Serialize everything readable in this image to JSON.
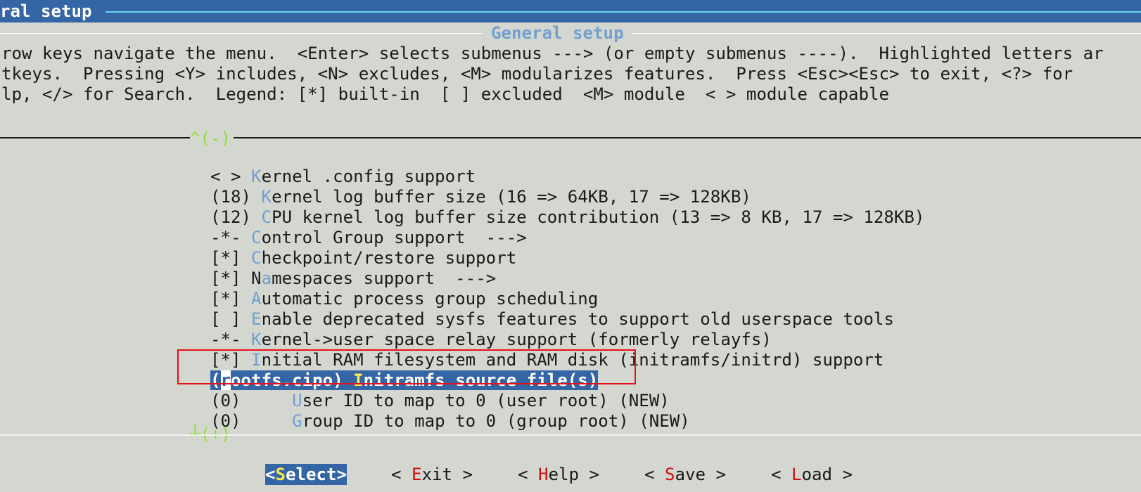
{
  "header": {
    "title": "ral setup"
  },
  "dialog": {
    "title": "General setup",
    "help_lines": [
      "row keys navigate the menu.  <Enter> selects submenus ---> (or empty submenus ----).  Highlighted letters ar",
      "tkeys.  Pressing <Y> includes, <N> excludes, <M> modularizes features.  Press <Esc><Esc> to exit, <?> for",
      "lp, </> for Search.  Legend: [*] built-in  [ ] excluded  <M> module  < > module capable"
    ]
  },
  "menu": {
    "scroll_up": "^(-)",
    "scroll_down": "┴(+)",
    "items": [
      {
        "prefix": "< > ",
        "pre_hot": "",
        "hot": "K",
        "rest": "ernel .config support"
      },
      {
        "prefix": "(18) ",
        "pre_hot": "",
        "hot": "K",
        "rest": "ernel log buffer size (16 => 64KB, 17 => 128KB)"
      },
      {
        "prefix": "(12) ",
        "pre_hot": "",
        "hot": "C",
        "rest": "PU kernel log buffer size contribution (13 => 8 KB, 17 => 128KB)"
      },
      {
        "prefix": "-*- ",
        "pre_hot": "",
        "hot": "C",
        "rest": "ontrol Group support  --->"
      },
      {
        "prefix": "[*] ",
        "pre_hot": "",
        "hot": "C",
        "rest": "heckpoint/restore support"
      },
      {
        "prefix": "[*] ",
        "pre_hot": "N",
        "hot": "a",
        "rest": "mespaces support  --->"
      },
      {
        "prefix": "[*] ",
        "pre_hot": "",
        "hot": "A",
        "rest": "utomatic process group scheduling"
      },
      {
        "prefix": "[ ] ",
        "pre_hot": "",
        "hot": "E",
        "rest": "nable deprecated sysfs features to support old userspace tools"
      },
      {
        "prefix": "-*- ",
        "pre_hot": "",
        "hot": "K",
        "rest": "ernel->user space relay support (formerly relayfs)"
      },
      {
        "prefix": "[*] ",
        "pre_hot": "",
        "hot": "I",
        "rest": "nitial RAM filesystem and RAM disk (initramfs/initrd) support"
      },
      {
        "prefix": "(rootfs.cipo) ",
        "pre_hot": "",
        "hot": "I",
        "rest": "nitramfs source file(s)"
      },
      {
        "prefix": "(0)     ",
        "pre_hot": "",
        "hot": "U",
        "rest": "ser ID to map to 0 (user root) (NEW)"
      },
      {
        "prefix": "(0)     ",
        "pre_hot": "",
        "hot": "G",
        "rest": "roup ID to map to 0 (group root) (NEW)"
      }
    ],
    "selected": {
      "open": "(",
      "cursor_char": "r",
      "value_rest": "ootfs.cipo) ",
      "hot": "I",
      "rest": "nitramfs source file(s)"
    }
  },
  "buttons": [
    {
      "pre": "<",
      "hot": "S",
      "post": "elect>"
    },
    {
      "pre": "< ",
      "hot": "E",
      "post": "xit >"
    },
    {
      "pre": "< ",
      "hot": "H",
      "post": "elp >"
    },
    {
      "pre": "< ",
      "hot": "S",
      "post": "ave >"
    },
    {
      "pre": "< ",
      "hot": "L",
      "post": "oad >"
    }
  ],
  "colors": {
    "title_bar": "#3465a4",
    "hotkey": "#729fcf",
    "scroll_indicator": "#8ae234",
    "selected_bg": "#3465a4",
    "selected_hotkey": "#fce94f",
    "annotation_box": "#e8101a"
  }
}
